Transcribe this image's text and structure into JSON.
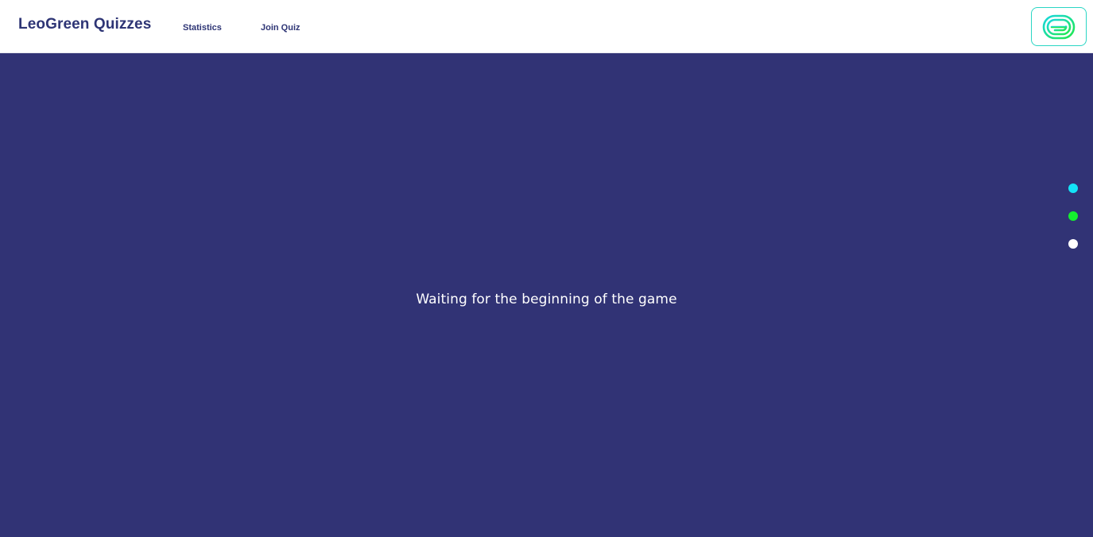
{
  "header": {
    "brand": "LeoGreen Quizzes",
    "nav": [
      {
        "label": "Statistics"
      },
      {
        "label": "Join Quiz"
      }
    ],
    "logo_icon": "leogreen-swirl-logo-icon"
  },
  "main": {
    "status_text": "Waiting for the beginning of the game"
  },
  "theme_dots": [
    {
      "name": "cyan",
      "color": "#13e3f7"
    },
    {
      "name": "green",
      "color": "#14ef2f"
    },
    {
      "name": "white",
      "color": "#ffffff"
    }
  ],
  "colors": {
    "background": "#313375",
    "brand_text": "#2e3575",
    "logo_accent": "#2ad6c4"
  }
}
